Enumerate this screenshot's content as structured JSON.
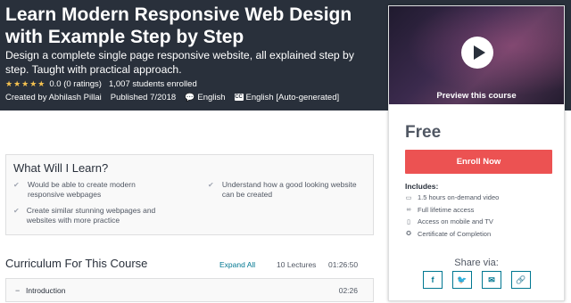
{
  "hero": {
    "title": "Learn Modern Responsive Web Design with Example Step by Step",
    "subtitle": "Design a complete single page responsive website, all explained step by step. Taught with practical approach.",
    "stars": "★★★★★",
    "rating": "0.0 (0 ratings)",
    "enrolled": "1,007 students enrolled",
    "created_by": "Created by Abhilash Pillai",
    "published": "Published 7/2018",
    "language": "English",
    "captions": "English [Auto-generated]",
    "cc_icon": "CC"
  },
  "sidebar": {
    "preview_label": "Preview this course",
    "price": "Free",
    "enroll_label": "Enroll Now",
    "includes_title": "Includes:",
    "includes": [
      {
        "icon": "video-icon",
        "glyph": "▭",
        "label": "1.5 hours on-demand video"
      },
      {
        "icon": "infinity-icon",
        "glyph": "∞",
        "label": "Full lifetime access"
      },
      {
        "icon": "mobile-icon",
        "glyph": "▯",
        "label": "Access on mobile and TV"
      },
      {
        "icon": "certificate-icon",
        "glyph": "✪",
        "label": "Certificate of Completion"
      }
    ],
    "share_label": "Share via:",
    "share": [
      {
        "icon": "facebook-icon",
        "glyph": "f"
      },
      {
        "icon": "twitter-icon",
        "glyph": "🐦"
      },
      {
        "icon": "email-icon",
        "glyph": "✉"
      },
      {
        "icon": "link-icon",
        "glyph": "🔗"
      }
    ]
  },
  "learn": {
    "title": "What Will I Learn?",
    "items": [
      "Would be able to create modern responsive webpages",
      "Understand how a good looking website can be created",
      "Create similar stunning webpages and websites with more practice"
    ],
    "check": "✔"
  },
  "curriculum": {
    "title": "Curriculum For This Course",
    "expand_label": "Expand All",
    "lectures": "10 Lectures",
    "total_duration": "01:26:50",
    "sections": [
      {
        "toggle": "−",
        "name": "Introduction",
        "duration": "02:26"
      }
    ]
  },
  "colors": {
    "hero_bg": "#29303b",
    "accent": "#ec5252",
    "link": "#007791",
    "star": "#f4c150"
  }
}
